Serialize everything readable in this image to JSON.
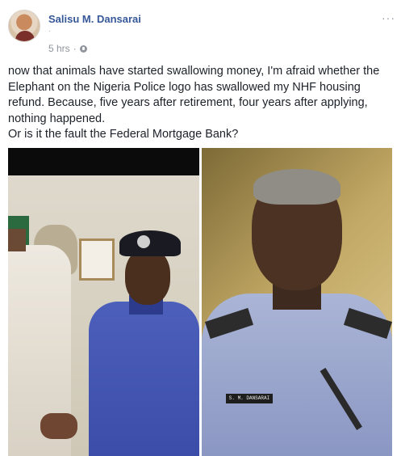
{
  "post": {
    "author_name": "Salisu M. Dansarai",
    "secondary_line": "·",
    "timestamp": "5 hrs",
    "meta_separator": "·",
    "privacy_icon": "globe-icon",
    "more_icon": "more-options-icon",
    "more_label": "···",
    "text_paragraphs": [
      "now that animals have started swallowing money, I'm afraid whether the Elephant on the Nigeria Police logo has swallowed my NHF housing refund. Because, five years after retirement, four years after applying, nothing happened.",
      "Or is it the fault the Federal Mortgage Bank?"
    ]
  },
  "photos": {
    "right_nametag": "S. M. DANSARAI"
  },
  "colors": {
    "author_link": "#365899",
    "meta_gray": "#90949c",
    "body_text": "#1d2129"
  }
}
